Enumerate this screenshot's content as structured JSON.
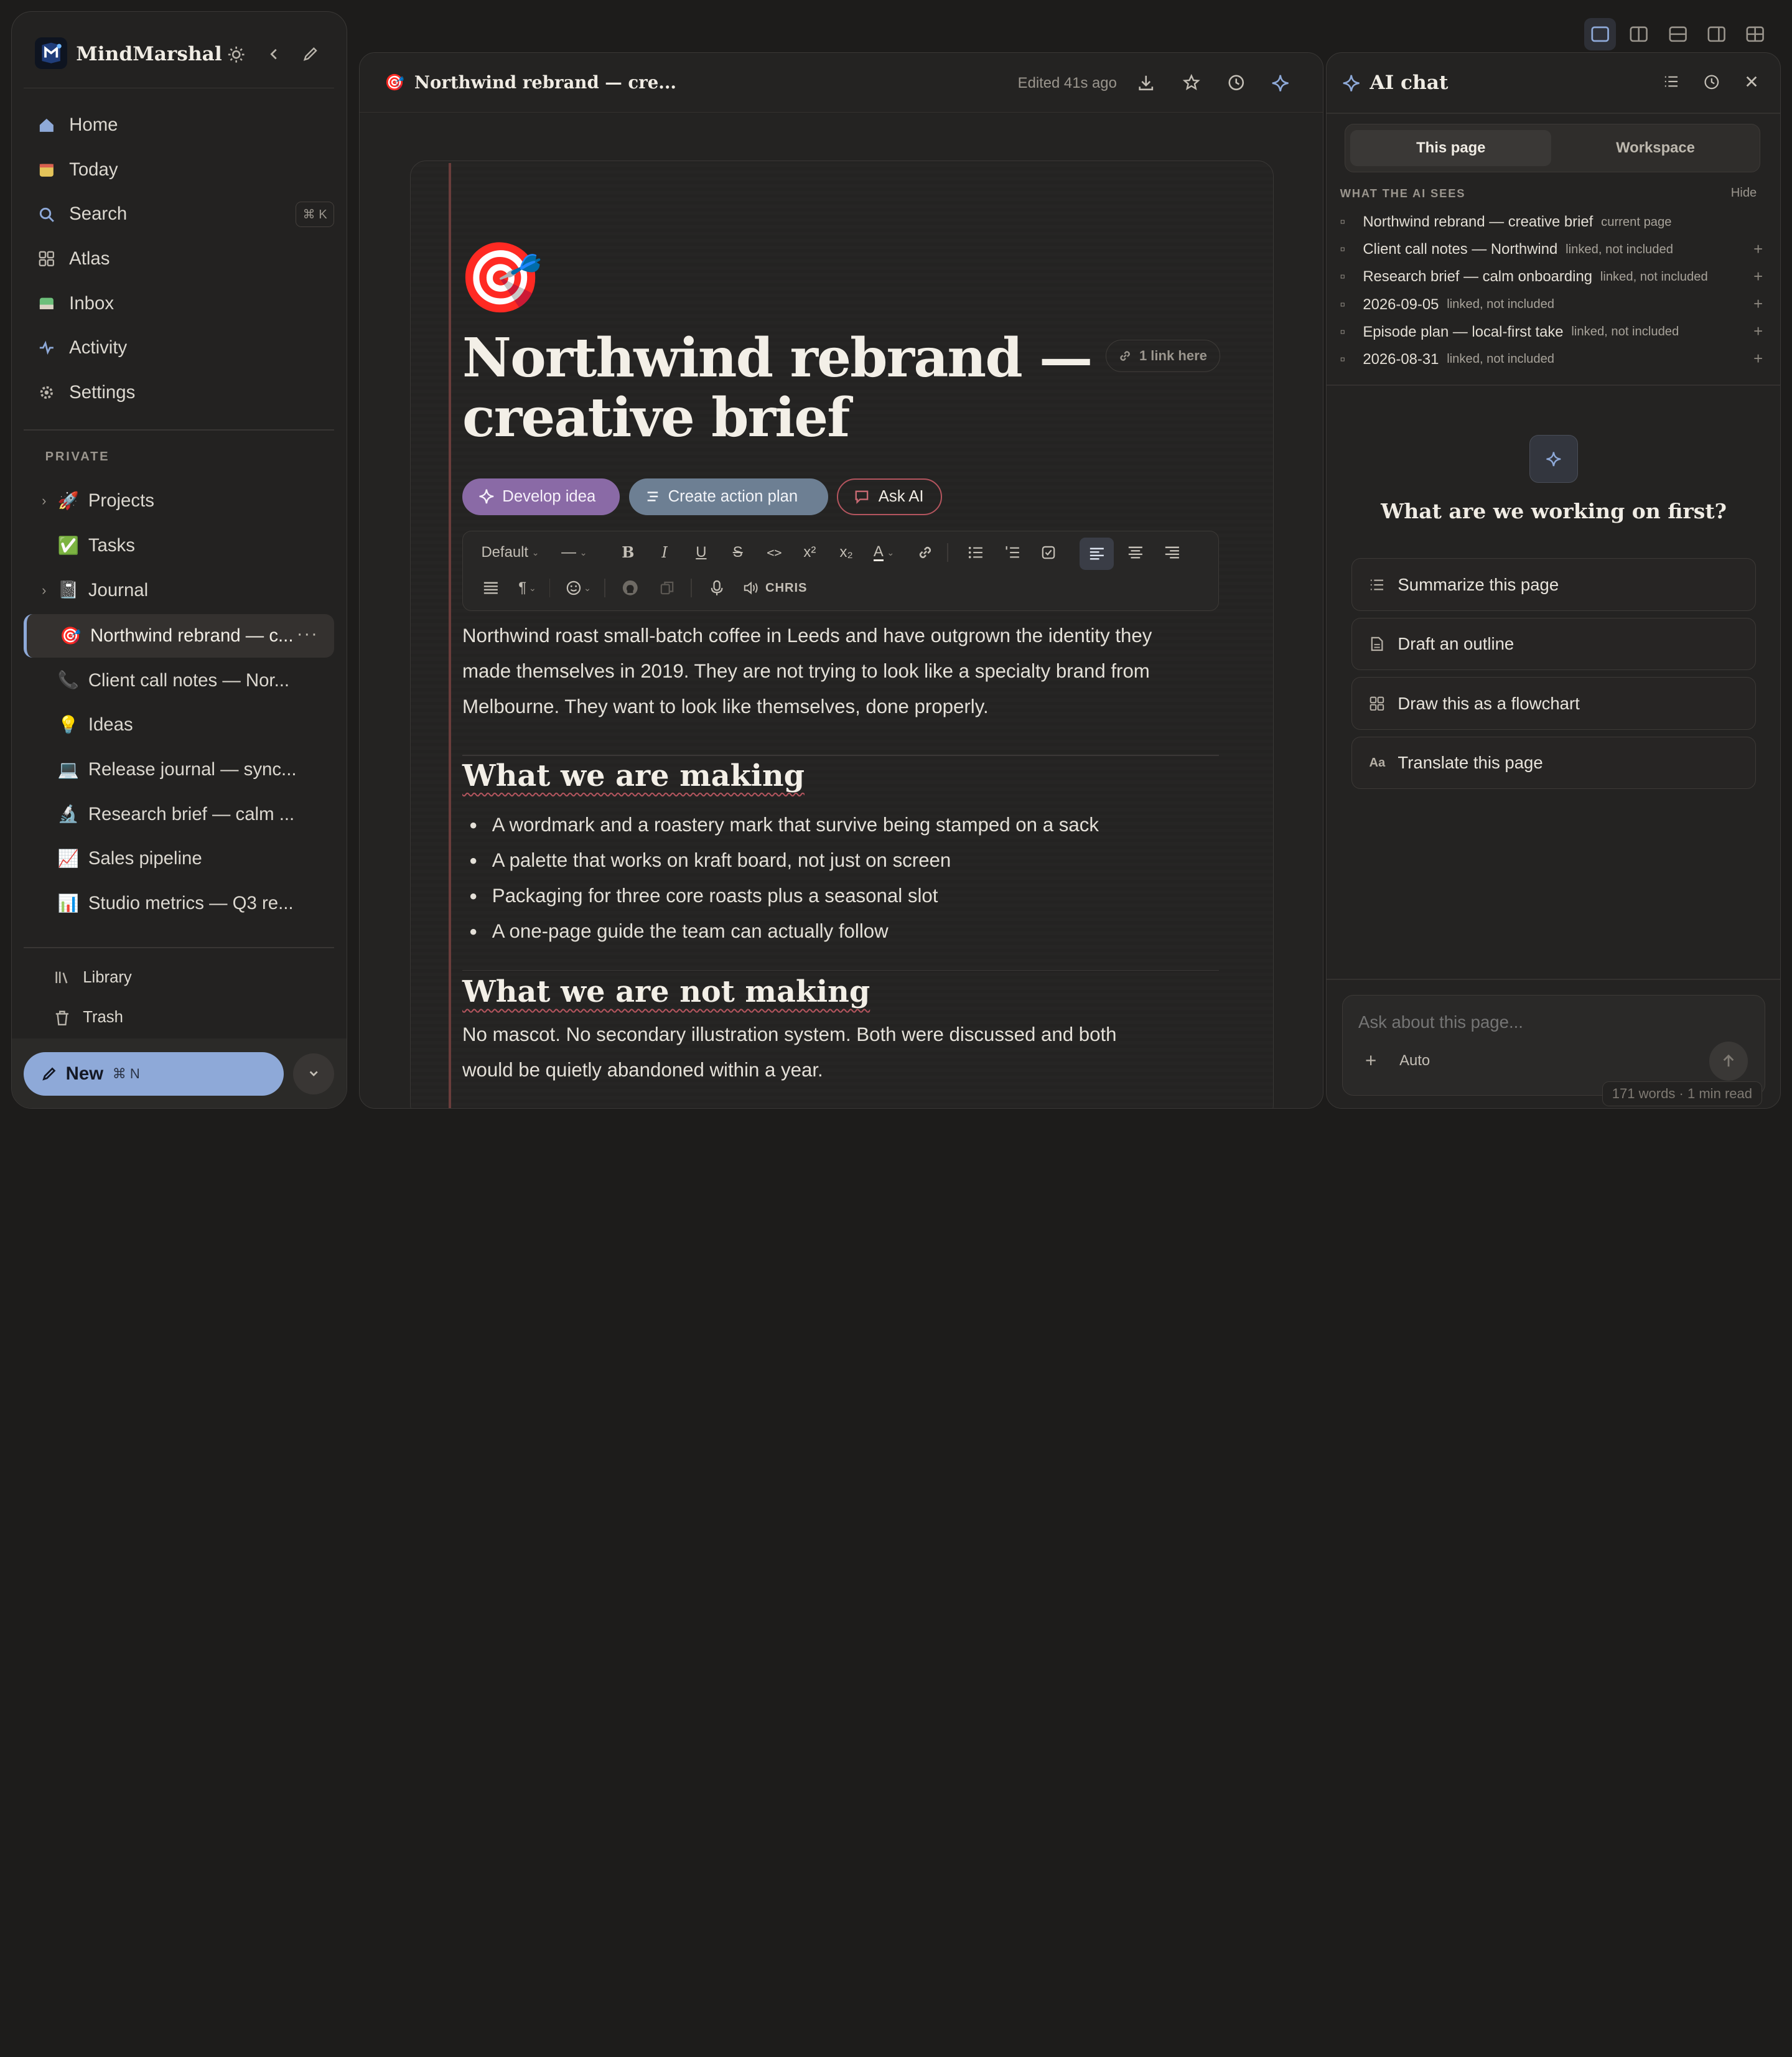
{
  "app": {
    "name": "MindMarshal"
  },
  "sidebar": {
    "nav": [
      {
        "label": "Home",
        "icon": "home-icon"
      },
      {
        "label": "Today",
        "icon": "calendar-icon"
      },
      {
        "label": "Search",
        "icon": "search-icon",
        "shortcut": "⌘ K"
      },
      {
        "label": "Atlas",
        "icon": "grid-icon"
      },
      {
        "label": "Inbox",
        "icon": "inbox-icon"
      },
      {
        "label": "Activity",
        "icon": "activity-icon"
      },
      {
        "label": "Settings",
        "icon": "settings-icon"
      }
    ],
    "section_label": "PRIVATE",
    "pages": [
      {
        "label": "Projects",
        "emoji": "🚀",
        "expandable": true
      },
      {
        "label": "Tasks",
        "emoji": "✅",
        "expandable": false
      },
      {
        "label": "Journal",
        "emoji": "📓",
        "expandable": true
      },
      {
        "label": "Northwind rebrand — c...",
        "emoji": "🎯",
        "active": true
      },
      {
        "label": "Client call notes — Nor...",
        "emoji": "📞"
      },
      {
        "label": "Ideas",
        "emoji": "💡"
      },
      {
        "label": "Release journal — sync...",
        "emoji": "💻"
      },
      {
        "label": "Research brief — calm ...",
        "emoji": "🔬"
      },
      {
        "label": "Sales pipeline",
        "emoji": "📈"
      },
      {
        "label": "Studio metrics — Q3 re...",
        "emoji": "📊"
      }
    ],
    "footer": [
      {
        "label": "Library",
        "icon": "library-icon"
      },
      {
        "label": "Trash",
        "icon": "trash-icon"
      }
    ],
    "new_button": {
      "label": "New",
      "shortcut": "⌘ N"
    }
  },
  "editor": {
    "tab_title": "Northwind rebrand — cre...",
    "edited": "Edited 41s ago",
    "icon_emoji": "🎯",
    "title_line1": "Northwind rebrand —",
    "title_line2": "creative brief",
    "backlinks": "1 link here",
    "actions": {
      "develop": "Develop idea",
      "plan": "Create action plan",
      "ask": "Ask AI"
    },
    "toolbar": {
      "style": "Default",
      "dash": "—",
      "voice": "CHRIS"
    },
    "intro": [
      "Northwind roast small-batch coffee in Leeds and have outgrown the identity they",
      "made themselves in 2019. They are not trying to look like a specialty brand from",
      "Melbourne. They want to look like themselves, done properly."
    ],
    "h2_making": "What we are making",
    "bullets": [
      "A wordmark and a roastery mark that survive being stamped on a sack",
      "A palette that works on kraft board, not just on screen",
      "Packaging for three core roasts plus a seasonal slot",
      "A one-page guide the team can actually follow"
    ],
    "h2_not": "What we are not making",
    "not_text": [
      "No mascot. No secondary illustration system. Both were discussed and both",
      "would be quietly abandoned within a year."
    ],
    "word_count": "171 words · 1 min read"
  },
  "ai": {
    "title": "AI chat",
    "tabs": [
      "This page",
      "Workspace"
    ],
    "context_header": "WHAT THE AI SEES",
    "hide": "Hide",
    "context": [
      {
        "title": "Northwind rebrand — creative brief",
        "note": "current page"
      },
      {
        "title": "Client call notes — Northwind",
        "note": "linked, not included"
      },
      {
        "title": "Research brief — calm onboarding",
        "note": "linked, not included"
      },
      {
        "title": "2026-09-05",
        "note": "linked, not included"
      },
      {
        "title": "Episode plan — local-first take",
        "note": "linked, not included"
      },
      {
        "title": "2026-08-31",
        "note": "linked, not included"
      }
    ],
    "prompt": "What are we working on first?",
    "suggestions": [
      {
        "label": "Summarize this page",
        "icon": "list-icon"
      },
      {
        "label": "Draft an outline",
        "icon": "document-icon"
      },
      {
        "label": "Draw this as a flowchart",
        "icon": "flowchart-icon"
      },
      {
        "label": "Translate this page",
        "icon": "translate-icon"
      }
    ],
    "input_placeholder": "Ask about this page...",
    "model": "Auto"
  },
  "colors": {
    "accent": "#8ea9d8",
    "develop": "#8a6aa6",
    "plan": "#6d7f93",
    "ask_border": "#b4555e"
  }
}
